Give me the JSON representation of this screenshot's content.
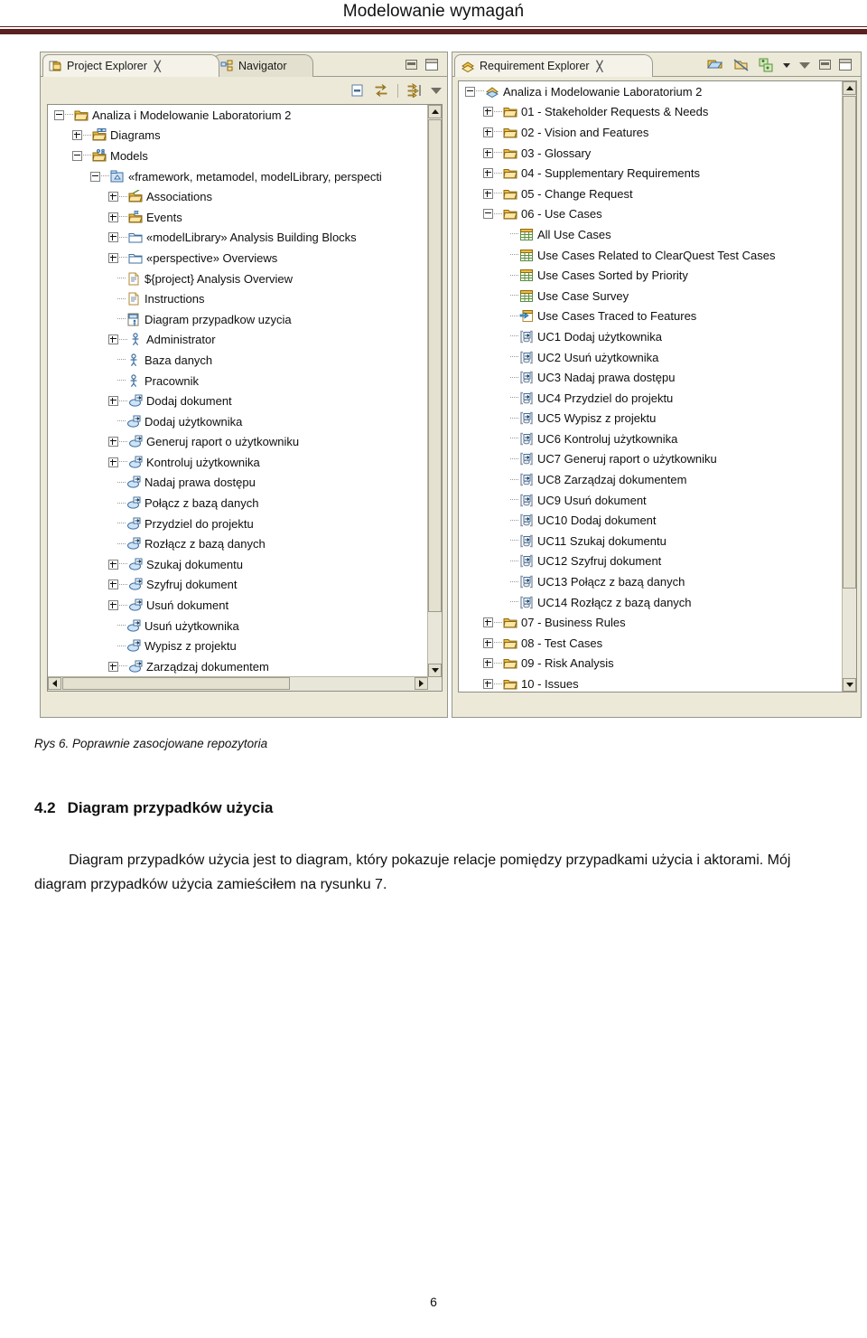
{
  "document": {
    "header_title": "Modelowanie wymagań",
    "figure_caption": "Rys 6. Poprawnie zasocjowane repozytoria",
    "section_number": "4.2",
    "section_title": "Diagram przypadków użycia",
    "paragraph": "Diagram przypadków użycia jest to diagram, który pokazuje relacje pomiędzy przypadkami użycia i aktorami. Mój diagram przypadków użycia zamieściłem na rysunku 7.",
    "page_number": "6",
    "accent_color": "#5b2121"
  },
  "left_panel": {
    "tabs": [
      {
        "label": "Project Explorer",
        "active": true,
        "close": "╳",
        "icon": "project-explorer-icon"
      },
      {
        "label": "Navigator",
        "active": false,
        "close": "",
        "icon": "navigator-icon"
      }
    ],
    "window_buttons": [
      "minimize",
      "maximize"
    ],
    "toolbar": [
      {
        "name": "collapse-all-icon"
      },
      {
        "name": "link-with-editor-icon"
      },
      {
        "name": "focus-on-active-task-icon"
      },
      {
        "name": "view-menu-icon"
      }
    ],
    "tree": [
      {
        "depth": 0,
        "toggle": "minus",
        "icon": "folder-project",
        "label": "Analiza i Modelowanie Laboratorium 2"
      },
      {
        "depth": 1,
        "toggle": "plus",
        "icon": "folder-diagrams",
        "label": "Diagrams"
      },
      {
        "depth": 1,
        "toggle": "minus",
        "icon": "folder-models",
        "label": "Models"
      },
      {
        "depth": 2,
        "toggle": "minus",
        "icon": "package-framework",
        "label": "«framework, metamodel, modelLibrary, perspecti"
      },
      {
        "depth": 3,
        "toggle": "plus",
        "icon": "folder-assoc",
        "label": "Associations"
      },
      {
        "depth": 3,
        "toggle": "plus",
        "icon": "folder-events",
        "label": "Events"
      },
      {
        "depth": 3,
        "toggle": "plus",
        "icon": "folder-blue",
        "label": "«modelLibrary» Analysis Building Blocks"
      },
      {
        "depth": 3,
        "toggle": "plus",
        "icon": "folder-blue",
        "label": "«perspective» Overviews"
      },
      {
        "depth": 3,
        "toggle": "none",
        "icon": "doc-page",
        "label": "${project} Analysis Overview"
      },
      {
        "depth": 3,
        "toggle": "none",
        "icon": "doc-page",
        "label": "Instructions"
      },
      {
        "depth": 3,
        "toggle": "none",
        "icon": "usecase-diagram",
        "label": "Diagram przypadkow uzycia"
      },
      {
        "depth": 3,
        "toggle": "plus",
        "icon": "actor",
        "label": "Administrator"
      },
      {
        "depth": 3,
        "toggle": "none",
        "icon": "actor",
        "label": "Baza danych"
      },
      {
        "depth": 3,
        "toggle": "none",
        "icon": "actor",
        "label": "Pracownik"
      },
      {
        "depth": 3,
        "toggle": "plus",
        "icon": "usecase",
        "label": "Dodaj dokument"
      },
      {
        "depth": 3,
        "toggle": "none",
        "icon": "usecase",
        "label": "Dodaj użytkownika"
      },
      {
        "depth": 3,
        "toggle": "plus",
        "icon": "usecase",
        "label": "Generuj raport o użytkowniku"
      },
      {
        "depth": 3,
        "toggle": "plus",
        "icon": "usecase",
        "label": "Kontroluj użytkownika"
      },
      {
        "depth": 3,
        "toggle": "none",
        "icon": "usecase",
        "label": "Nadaj prawa dostępu"
      },
      {
        "depth": 3,
        "toggle": "none",
        "icon": "usecase",
        "label": "Połącz z bazą danych"
      },
      {
        "depth": 3,
        "toggle": "none",
        "icon": "usecase",
        "label": "Przydziel do projektu"
      },
      {
        "depth": 3,
        "toggle": "none",
        "icon": "usecase",
        "label": "Rozłącz z bazą danych"
      },
      {
        "depth": 3,
        "toggle": "plus",
        "icon": "usecase",
        "label": "Szukaj dokumentu"
      },
      {
        "depth": 3,
        "toggle": "plus",
        "icon": "usecase",
        "label": "Szyfruj dokument"
      },
      {
        "depth": 3,
        "toggle": "plus",
        "icon": "usecase",
        "label": "Usuń dokument"
      },
      {
        "depth": 3,
        "toggle": "none",
        "icon": "usecase",
        "label": "Usuń użytkownika"
      },
      {
        "depth": 3,
        "toggle": "none",
        "icon": "usecase",
        "label": "Wypisz z projektu"
      },
      {
        "depth": 3,
        "toggle": "plus",
        "icon": "usecase",
        "label": "Zarządzaj dokumentem"
      }
    ]
  },
  "right_panel": {
    "tabs": [
      {
        "label": "Requirement Explorer",
        "active": true,
        "close": "╳",
        "icon": "requirement-explorer-icon"
      }
    ],
    "window_buttons": [
      "minimize",
      "maximize"
    ],
    "toolbar": [
      {
        "name": "open-repository-icon"
      },
      {
        "name": "disconnect-repository-icon"
      },
      {
        "name": "new-element-icon"
      },
      {
        "name": "toolbar-dropdown-icon"
      },
      {
        "name": "view-menu-icon"
      }
    ],
    "tree": [
      {
        "depth": 0,
        "toggle": "minus",
        "icon": "repository",
        "label": "Analiza i Modelowanie Laboratorium 2"
      },
      {
        "depth": 1,
        "toggle": "plus",
        "icon": "folder-yellow",
        "label": "01 - Stakeholder Requests &  Needs"
      },
      {
        "depth": 1,
        "toggle": "plus",
        "icon": "folder-yellow",
        "label": "02 - Vision and Features"
      },
      {
        "depth": 1,
        "toggle": "plus",
        "icon": "folder-yellow",
        "label": "03 - Glossary"
      },
      {
        "depth": 1,
        "toggle": "plus",
        "icon": "folder-yellow",
        "label": "04 - Supplementary Requirements"
      },
      {
        "depth": 1,
        "toggle": "plus",
        "icon": "folder-yellow",
        "label": "05 - Change Request"
      },
      {
        "depth": 1,
        "toggle": "minus",
        "icon": "folder-yellow",
        "label": "06 - Use Cases"
      },
      {
        "depth": 2,
        "toggle": "none",
        "icon": "view-table",
        "label": "All Use Cases"
      },
      {
        "depth": 2,
        "toggle": "none",
        "icon": "view-table",
        "label": "Use Cases Related to ClearQuest Test Cases"
      },
      {
        "depth": 2,
        "toggle": "none",
        "icon": "view-table",
        "label": "Use Cases Sorted by Priority"
      },
      {
        "depth": 2,
        "toggle": "none",
        "icon": "view-table",
        "label": "Use Case Survey"
      },
      {
        "depth": 2,
        "toggle": "none",
        "icon": "view-trace",
        "label": "Use Cases Traced to Features"
      },
      {
        "depth": 2,
        "toggle": "none",
        "icon": "req-usecase",
        "label": "UC1 Dodaj użytkownika"
      },
      {
        "depth": 2,
        "toggle": "none",
        "icon": "req-usecase",
        "label": "UC2 Usuń użytkownika"
      },
      {
        "depth": 2,
        "toggle": "none",
        "icon": "req-usecase",
        "label": "UC3 Nadaj prawa dostępu"
      },
      {
        "depth": 2,
        "toggle": "none",
        "icon": "req-usecase",
        "label": "UC4 Przydziel do projektu"
      },
      {
        "depth": 2,
        "toggle": "none",
        "icon": "req-usecase",
        "label": "UC5 Wypisz z projektu"
      },
      {
        "depth": 2,
        "toggle": "none",
        "icon": "req-usecase",
        "label": "UC6 Kontroluj użytkownika"
      },
      {
        "depth": 2,
        "toggle": "none",
        "icon": "req-usecase",
        "label": "UC7 Generuj raport o użytkowniku"
      },
      {
        "depth": 2,
        "toggle": "none",
        "icon": "req-usecase",
        "label": "UC8 Zarządzaj dokumentem"
      },
      {
        "depth": 2,
        "toggle": "none",
        "icon": "req-usecase",
        "label": "UC9 Usuń dokument"
      },
      {
        "depth": 2,
        "toggle": "none",
        "icon": "req-usecase",
        "label": "UC10 Dodaj dokument"
      },
      {
        "depth": 2,
        "toggle": "none",
        "icon": "req-usecase",
        "label": "UC11 Szukaj dokumentu"
      },
      {
        "depth": 2,
        "toggle": "none",
        "icon": "req-usecase",
        "label": "UC12 Szyfruj dokument"
      },
      {
        "depth": 2,
        "toggle": "none",
        "icon": "req-usecase",
        "label": "UC13 Połącz z bazą danych"
      },
      {
        "depth": 2,
        "toggle": "none",
        "icon": "req-usecase",
        "label": "UC14 Rozłącz z bazą danych"
      },
      {
        "depth": 1,
        "toggle": "plus",
        "icon": "folder-yellow",
        "label": "07 - Business Rules"
      },
      {
        "depth": 1,
        "toggle": "plus",
        "icon": "folder-yellow",
        "label": "08 - Test Cases"
      },
      {
        "depth": 1,
        "toggle": "plus",
        "icon": "folder-yellow",
        "label": "09 - Risk Analysis"
      },
      {
        "depth": 1,
        "toggle": "plus",
        "icon": "folder-yellow",
        "label": "10 - Issues"
      },
      {
        "depth": 1,
        "toggle": "plus",
        "icon": "folder-yellow",
        "label": ""
      }
    ]
  }
}
